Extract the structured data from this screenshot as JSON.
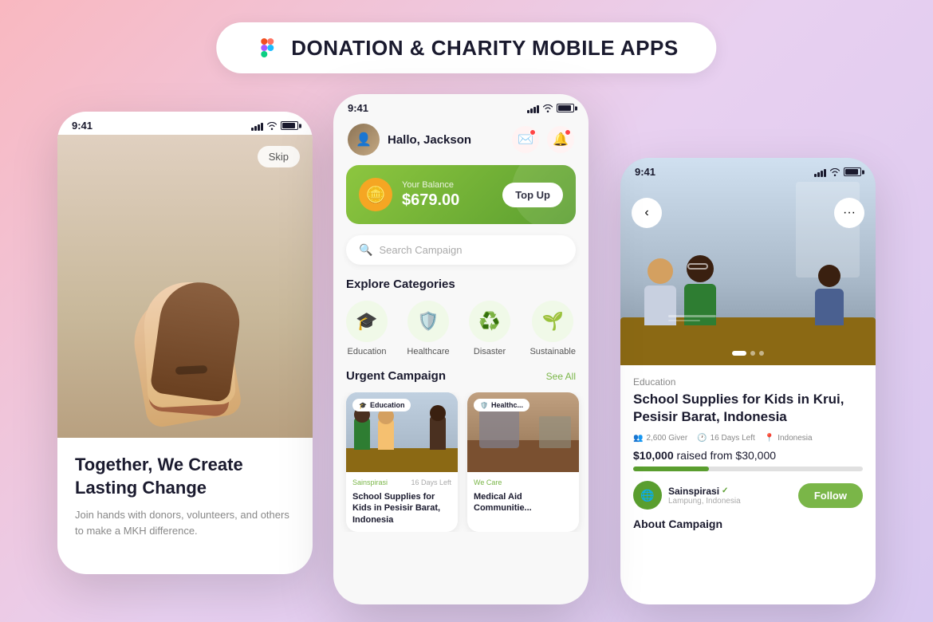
{
  "header": {
    "title": "DONATION & CHARITY MOBILE APPS",
    "figma_icon": "figma"
  },
  "phone_left": {
    "status_time": "9:41",
    "skip_label": "Skip",
    "hero_title": "Together, We Create Lasting Change",
    "hero_desc": "Join hands with donors, volunteers, and others to make a MKH difference."
  },
  "phone_center": {
    "status_time": "9:41",
    "greeting": "Hallo, Jackson",
    "balance_label": "Your Balance",
    "balance_amount": "$679.00",
    "topup_label": "Top Up",
    "search_placeholder": "Search Campaign",
    "explore_title": "Explore Categories",
    "categories": [
      {
        "icon": "🎓",
        "label": "Education"
      },
      {
        "icon": "🛡",
        "label": "Healthcare"
      },
      {
        "icon": "♻",
        "label": "Disaster"
      },
      {
        "icon": "🌱",
        "label": "Sustainable"
      }
    ],
    "urgent_title": "Urgent Campaign",
    "see_all": "See All",
    "campaigns": [
      {
        "tag": "Education",
        "org": "Sainspirasi",
        "days": "16 Days Left",
        "title": "School Supplies for Kids in Pesisir Barat, Indonesia"
      },
      {
        "tag": "Healthc...",
        "org": "We Care",
        "days": "",
        "title": "Medical Aid Communitie..."
      }
    ]
  },
  "phone_right": {
    "status_time": "9:41",
    "category_label": "Education",
    "title": "School Supplies for Kids in Krui, Pesisir Barat, Indonesia",
    "givers": "2,600 Giver",
    "days_left": "16 Days Left",
    "location": "Indonesia",
    "raised_amount": "$10,000",
    "raised_from": "raised from $30,000",
    "progress_percent": 33,
    "org_name": "Sainspirasi",
    "org_location": "Lampung, Indonesia",
    "follow_label": "Follow",
    "about_label": "About Campaign"
  }
}
